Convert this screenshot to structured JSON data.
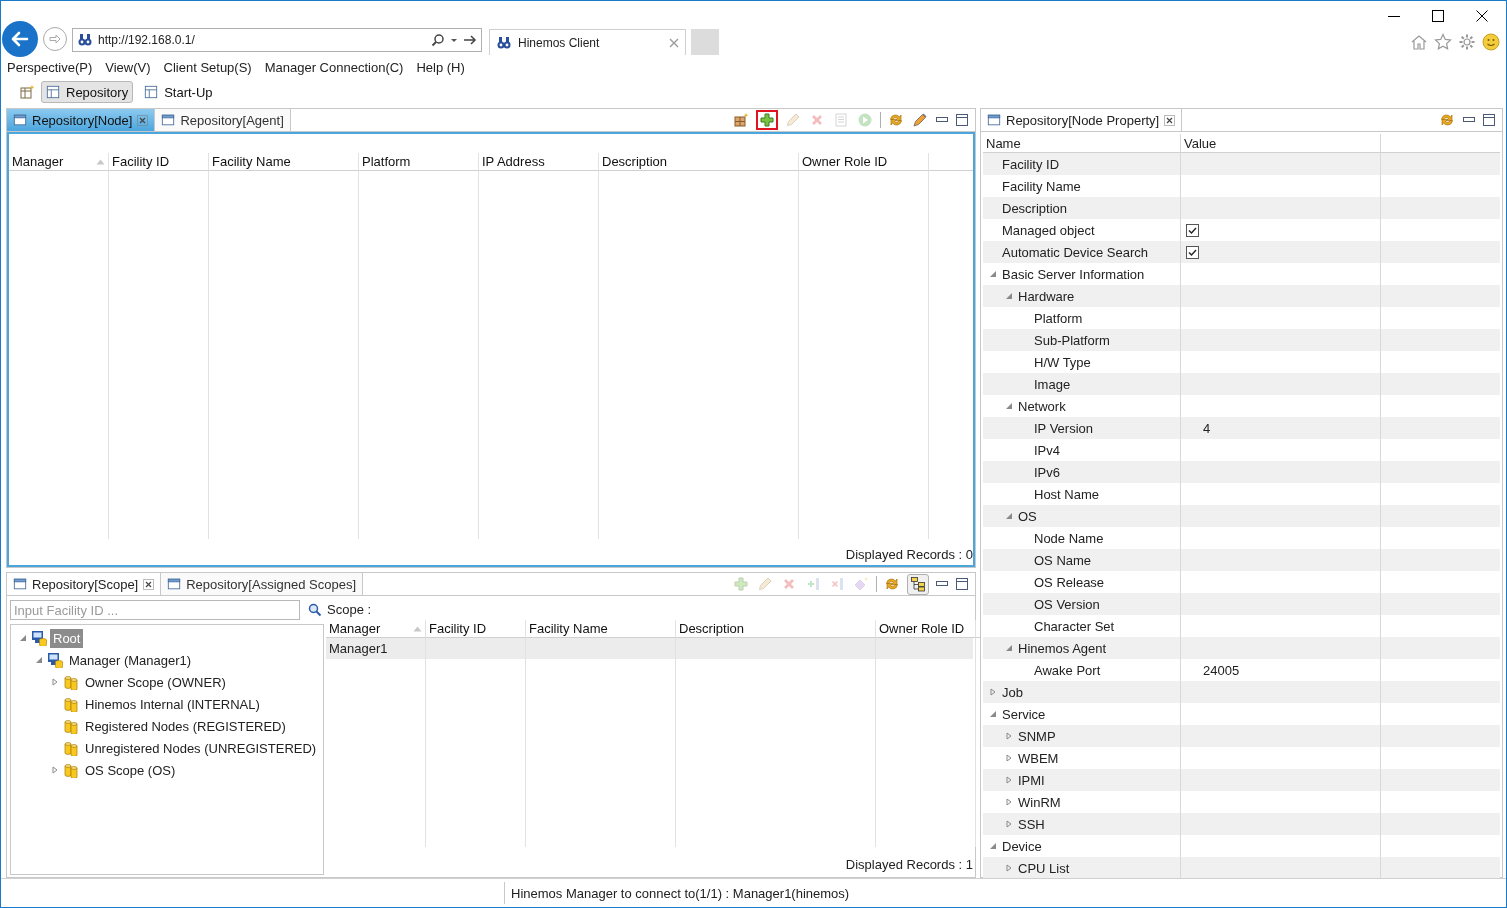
{
  "browser": {
    "url": "http://192.168.0.1/",
    "tab": {
      "title": "Hinemos Client"
    }
  },
  "menu": [
    "Perspective(P)",
    "View(V)",
    "Client Setup(S)",
    "Manager Connection(C)",
    "Help (H)"
  ],
  "perspectives": [
    {
      "label": "Repository",
      "selected": true
    },
    {
      "label": "Start-Up",
      "selected": false
    }
  ],
  "node_view": {
    "active": true,
    "tabs": [
      {
        "label": "Repository[Node]",
        "selected": true,
        "closable": true
      },
      {
        "label": "Repository[Agent]",
        "selected": false,
        "closable": false
      }
    ],
    "toolbar": [
      {
        "kind": "grid",
        "disabled": false,
        "highlighted": false
      },
      {
        "kind": "add",
        "disabled": false,
        "highlighted": true
      },
      {
        "kind": "edit",
        "disabled": true,
        "highlighted": false
      },
      {
        "kind": "delete",
        "disabled": true,
        "highlighted": false
      },
      {
        "kind": "copy",
        "disabled": true,
        "highlighted": false
      },
      {
        "kind": "run",
        "disabled": true,
        "highlighted": false
      },
      {
        "kind": "separator"
      },
      {
        "kind": "refresh",
        "disabled": false,
        "highlighted": false
      },
      {
        "kind": "pen",
        "disabled": false,
        "highlighted": false
      }
    ],
    "table": {
      "columns": [
        {
          "label": "Manager",
          "sorted": true
        },
        {
          "label": "Facility ID",
          "sorted": false
        },
        {
          "label": "Facility Name",
          "sorted": false
        },
        {
          "label": "Platform",
          "sorted": false
        },
        {
          "label": "IP Address",
          "sorted": false
        },
        {
          "label": "Description",
          "sorted": false
        },
        {
          "label": "Owner Role ID",
          "sorted": false
        }
      ]
    },
    "footer": "Displayed Records : 0"
  },
  "scope_view": {
    "active": false,
    "tabs": [
      {
        "label": "Repository[Scope]",
        "selected": true,
        "closable": true
      },
      {
        "label": "Repository[Assigned Scopes]",
        "selected": false,
        "closable": false
      }
    ],
    "toolbar": [
      {
        "kind": "add",
        "disabled": true,
        "pressed": false
      },
      {
        "kind": "edit",
        "disabled": true,
        "pressed": false
      },
      {
        "kind": "delete",
        "disabled": true,
        "pressed": false
      },
      {
        "kind": "add-node",
        "disabled": true,
        "pressed": false
      },
      {
        "kind": "remove-node",
        "disabled": true,
        "pressed": false
      },
      {
        "kind": "diamond",
        "disabled": true,
        "pressed": false
      },
      {
        "kind": "separator"
      },
      {
        "kind": "refresh",
        "disabled": false,
        "pressed": false
      },
      {
        "kind": "tree",
        "disabled": false,
        "pressed": true
      }
    ],
    "search": {
      "placeholder": "Input Facility ID ..."
    },
    "tree": [
      {
        "label": "Root",
        "kind": "manager",
        "selected": true,
        "expanded": true,
        "children": [
          {
            "label": "Manager (Manager1)",
            "kind": "manager",
            "selected": false,
            "expanded": true,
            "children": [
              {
                "label": "Owner Scope (OWNER)",
                "kind": "scope",
                "selected": false,
                "expanded": false
              },
              {
                "label": "Hinemos Internal (INTERNAL)",
                "kind": "scope",
                "selected": false
              },
              {
                "label": "Registered Nodes (REGISTERED)",
                "kind": "scope",
                "selected": false
              },
              {
                "label": "Unregistered Nodes (UNREGISTERED)",
                "kind": "scope",
                "selected": false
              },
              {
                "label": "OS Scope (OS)",
                "kind": "scope",
                "selected": false,
                "expanded": false
              }
            ]
          }
        ]
      }
    ],
    "scope_label": "Scope :",
    "table": {
      "columns": [
        {
          "label": "Manager",
          "sorted": true
        },
        {
          "label": "Facility ID",
          "sorted": false
        },
        {
          "label": "Facility Name",
          "sorted": false
        },
        {
          "label": "Description",
          "sorted": false
        },
        {
          "label": "Owner Role ID",
          "sorted": false
        }
      ],
      "rows": [
        {
          "cells": [
            "Manager1"
          ]
        }
      ]
    },
    "footer": "Displayed Records : 1"
  },
  "property_view": {
    "active": false,
    "tabs": [
      {
        "label": "Repository[Node Property]",
        "selected": true,
        "closable": true
      }
    ],
    "toolbar": [
      {
        "kind": "refresh",
        "disabled": false
      }
    ],
    "columns": [
      "Name",
      "Value"
    ],
    "rows": [
      {
        "name": "Facility ID"
      },
      {
        "name": "Facility Name"
      },
      {
        "name": "Description"
      },
      {
        "name": "Managed object",
        "kind": "check",
        "checked": true
      },
      {
        "name": "Automatic Device Search",
        "kind": "check",
        "checked": true
      },
      {
        "name": "Basic Server Information",
        "expanded": true,
        "children": [
          {
            "name": "Hardware",
            "expanded": true,
            "children": [
              {
                "name": "Platform"
              },
              {
                "name": "Sub-Platform"
              },
              {
                "name": "H/W Type"
              },
              {
                "name": "Image"
              }
            ]
          },
          {
            "name": "Network",
            "expanded": true,
            "children": [
              {
                "name": "IP Version",
                "value": "4"
              },
              {
                "name": "IPv4"
              },
              {
                "name": "IPv6"
              },
              {
                "name": "Host Name"
              }
            ]
          },
          {
            "name": "OS",
            "expanded": true,
            "children": [
              {
                "name": "Node Name"
              },
              {
                "name": "OS Name"
              },
              {
                "name": "OS Release"
              },
              {
                "name": "OS Version"
              },
              {
                "name": "Character Set"
              }
            ]
          },
          {
            "name": "Hinemos Agent",
            "expanded": true,
            "children": [
              {
                "name": "Awake Port",
                "value": "24005"
              }
            ]
          }
        ]
      },
      {
        "name": "Job",
        "expanded": false
      },
      {
        "name": "Service",
        "expanded": true,
        "children": [
          {
            "name": "SNMP",
            "expanded": false
          },
          {
            "name": "WBEM",
            "expanded": false
          },
          {
            "name": "IPMI",
            "expanded": false
          },
          {
            "name": "WinRM",
            "expanded": false
          },
          {
            "name": "SSH",
            "expanded": false
          }
        ]
      },
      {
        "name": "Device",
        "expanded": true,
        "children": [
          {
            "name": "CPU List",
            "expanded": false
          }
        ]
      }
    ]
  },
  "status": "Hinemos Manager to connect to(1/1) : Manager1(hinemos)"
}
